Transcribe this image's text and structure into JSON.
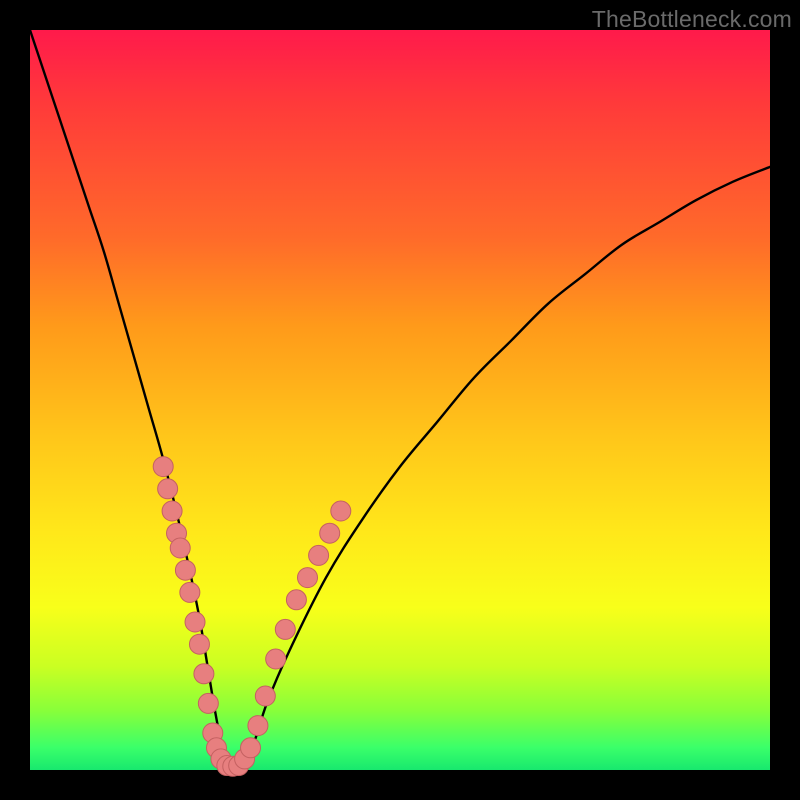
{
  "watermark": {
    "text": "TheBottleneck.com"
  },
  "colors": {
    "curve": "#000000",
    "marker_fill": "#e77f7f",
    "marker_stroke": "#c46161"
  },
  "chart_data": {
    "type": "line",
    "title": "",
    "xlabel": "",
    "ylabel": "",
    "xlim": [
      0,
      100
    ],
    "ylim": [
      0,
      100
    ],
    "grid": false,
    "legend": false,
    "series": [
      {
        "name": "bottleneck-curve",
        "x": [
          0,
          2,
          4,
          6,
          8,
          10,
          12,
          14,
          16,
          18,
          20,
          22,
          23,
          24,
          25,
          26,
          27,
          28,
          30,
          32,
          35,
          40,
          45,
          50,
          55,
          60,
          65,
          70,
          75,
          80,
          85,
          90,
          95,
          100
        ],
        "values": [
          100,
          94,
          88,
          82,
          76,
          70,
          63,
          56,
          49,
          42,
          34,
          25,
          20,
          14,
          8,
          3,
          0,
          0,
          3,
          9,
          16,
          26,
          34,
          41,
          47,
          53,
          58,
          63,
          67,
          71,
          74,
          77,
          79.5,
          81.5
        ]
      }
    ],
    "markers": [
      {
        "x": 18.0,
        "y": 41
      },
      {
        "x": 18.6,
        "y": 38
      },
      {
        "x": 19.2,
        "y": 35
      },
      {
        "x": 19.8,
        "y": 32
      },
      {
        "x": 20.3,
        "y": 30
      },
      {
        "x": 21.0,
        "y": 27
      },
      {
        "x": 21.6,
        "y": 24
      },
      {
        "x": 22.3,
        "y": 20
      },
      {
        "x": 22.9,
        "y": 17
      },
      {
        "x": 23.5,
        "y": 13
      },
      {
        "x": 24.1,
        "y": 9
      },
      {
        "x": 24.7,
        "y": 5
      },
      {
        "x": 25.2,
        "y": 3
      },
      {
        "x": 25.8,
        "y": 1.5
      },
      {
        "x": 26.6,
        "y": 0.6
      },
      {
        "x": 27.4,
        "y": 0.5
      },
      {
        "x": 28.2,
        "y": 0.6
      },
      {
        "x": 29.0,
        "y": 1.5
      },
      {
        "x": 29.8,
        "y": 3
      },
      {
        "x": 30.8,
        "y": 6
      },
      {
        "x": 31.8,
        "y": 10
      },
      {
        "x": 33.2,
        "y": 15
      },
      {
        "x": 34.5,
        "y": 19
      },
      {
        "x": 36.0,
        "y": 23
      },
      {
        "x": 37.5,
        "y": 26
      },
      {
        "x": 39.0,
        "y": 29
      },
      {
        "x": 40.5,
        "y": 32
      },
      {
        "x": 42.0,
        "y": 35
      }
    ]
  }
}
